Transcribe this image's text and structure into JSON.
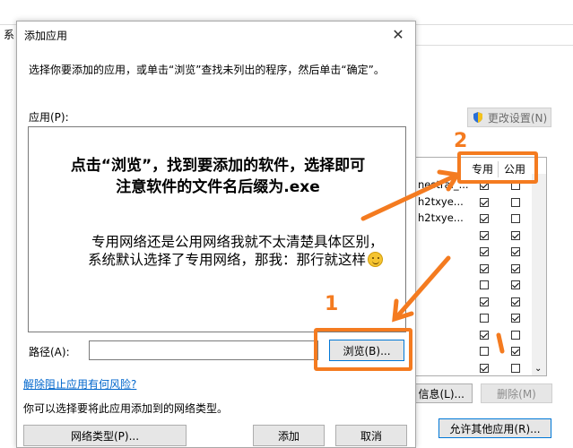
{
  "background": {
    "title_fragment": "系",
    "change_settings_label": "更改设置(N)",
    "columns": {
      "private": "专用",
      "public": "公用"
    },
    "rows": [
      {
        "name": "nestral_...",
        "private": true,
        "public": false
      },
      {
        "name": "h2txye...",
        "private": true,
        "public": false
      },
      {
        "name": "h2txye...",
        "private": true,
        "public": false
      },
      {
        "name": "",
        "private": true,
        "public": true
      },
      {
        "name": "",
        "private": true,
        "public": true
      },
      {
        "name": "",
        "private": true,
        "public": true
      },
      {
        "name": "",
        "private": false,
        "public": true
      },
      {
        "name": "",
        "private": true,
        "public": true
      },
      {
        "name": "",
        "private": false,
        "public": true
      },
      {
        "name": "",
        "private": true,
        "public": false
      },
      {
        "name": "",
        "private": false,
        "public": true
      },
      {
        "name": "",
        "private": true,
        "public": false
      }
    ],
    "details_button": "信息(L)...",
    "delete_button": "删除(M)",
    "allow_other_button": "允许其他应用(R)..."
  },
  "dialog": {
    "title": "添加应用",
    "instruction": "选择你要添加的应用，或单击“浏览”查找未列出的程序，然后单击“确定”。",
    "apps_label": "应用(P):",
    "path_label": "路径(A):",
    "path_value": "",
    "browse_button": "浏览(B)...",
    "risk_link": "解除阻止应用有何风险?",
    "network_hint": "你可以选择要将此应用添加到的网络类型。",
    "network_types_button": "网络类型(P)...",
    "add_button": "添加",
    "cancel_button": "取消"
  },
  "annotations": {
    "line1": "点击“浏览”，找到要添加的软件，选择即可",
    "line2": "注意软件的文件名后缀为.exe",
    "line3": "专用网络还是公用网络我就不太清楚具体区别，",
    "line4": "系统默认选择了专用网络，那我：那行就这样",
    "step1": "1",
    "step2": "2",
    "accent_color": "#f47b20"
  }
}
